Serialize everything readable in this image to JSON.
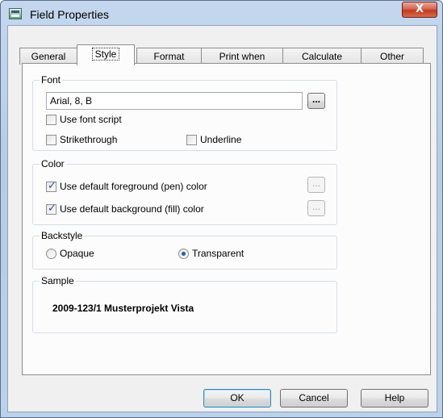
{
  "window": {
    "title": "Field Properties",
    "close_label": "X"
  },
  "tabs": [
    {
      "label": "General",
      "active": false
    },
    {
      "label": "Style",
      "active": true
    },
    {
      "label": "Format",
      "active": false
    },
    {
      "label": "Print when",
      "active": false
    },
    {
      "label": "Calculate",
      "active": false
    },
    {
      "label": "Other",
      "active": false
    }
  ],
  "font_group": {
    "label": "Font",
    "value": "Arial, 8, B",
    "browse_label": "...",
    "use_font_script": {
      "label": "Use font script",
      "checked": false
    },
    "strikethrough": {
      "label": "Strikethrough",
      "checked": false
    },
    "underline": {
      "label": "Underline",
      "checked": false
    }
  },
  "color_group": {
    "label": "Color",
    "foreground": {
      "label": "Use default foreground (pen) color",
      "checked": true,
      "button": "..."
    },
    "background": {
      "label": "Use default background (fill) color",
      "checked": true,
      "button": "..."
    }
  },
  "backstyle_group": {
    "label": "Backstyle",
    "opaque": {
      "label": "Opaque",
      "selected": false
    },
    "transparent": {
      "label": "Transparent",
      "selected": true
    }
  },
  "sample_group": {
    "label": "Sample",
    "text": "2009-123/1 Musterprojekt Vista"
  },
  "buttons": {
    "ok": "OK",
    "cancel": "Cancel",
    "help": "Help"
  }
}
